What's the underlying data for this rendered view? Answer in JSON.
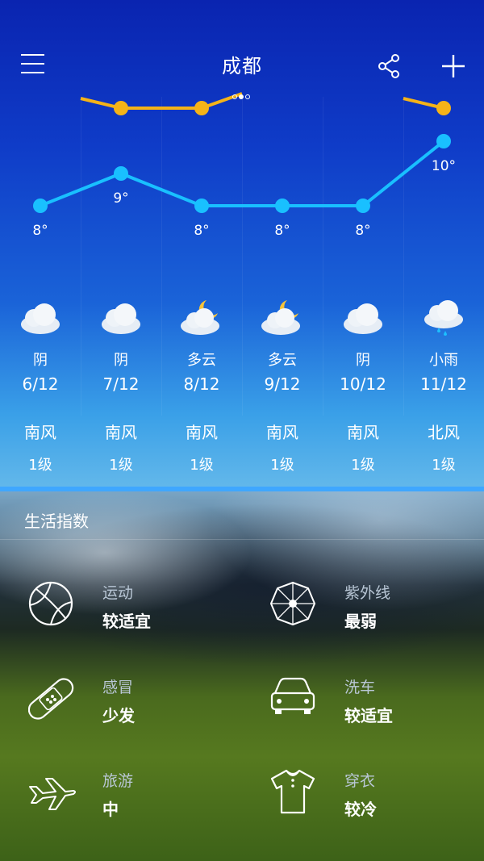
{
  "header": {
    "city": "成都",
    "page_count": 3,
    "active_page": 1
  },
  "chart_data": {
    "type": "line",
    "categories": [
      "6/12",
      "7/12",
      "8/12",
      "9/12",
      "10/12",
      "11/12"
    ],
    "series": [
      {
        "values": [
          8,
          9,
          8,
          8,
          8,
          10
        ],
        "labels": [
          "8°",
          "9°",
          "8°",
          "8°",
          "8°",
          "10°"
        ],
        "color": "#19c0ff"
      }
    ],
    "ylim": [
      3,
      11
    ],
    "partially_visible_series_color": "#f5b318"
  },
  "forecast": [
    {
      "condition": "阴",
      "date": "6/12",
      "icon": "cloudy-icon"
    },
    {
      "condition": "阴",
      "date": "7/12",
      "icon": "cloudy-icon"
    },
    {
      "condition": "多云",
      "date": "8/12",
      "icon": "cloud-moon-icon"
    },
    {
      "condition": "多云",
      "date": "9/12",
      "icon": "cloud-moon-icon"
    },
    {
      "condition": "阴",
      "date": "10/12",
      "icon": "cloudy-icon"
    },
    {
      "condition": "小雨",
      "date": "11/12",
      "icon": "light-rain-icon"
    }
  ],
  "wind": [
    {
      "direction": "南风",
      "level": "1级"
    },
    {
      "direction": "南风",
      "level": "1级"
    },
    {
      "direction": "南风",
      "level": "1级"
    },
    {
      "direction": "南风",
      "level": "1级"
    },
    {
      "direction": "南风",
      "level": "1级"
    },
    {
      "direction": "北风",
      "level": "1级"
    }
  ],
  "life_index": {
    "title": "生活指数",
    "items": [
      {
        "name": "运动",
        "value": "较适宜",
        "icon": "basketball-icon"
      },
      {
        "name": "紫外线",
        "value": "最弱",
        "icon": "umbrella-icon"
      },
      {
        "name": "感冒",
        "value": "少发",
        "icon": "bandage-icon"
      },
      {
        "name": "洗车",
        "value": "较适宜",
        "icon": "car-icon"
      },
      {
        "name": "旅游",
        "value": "中",
        "icon": "airplane-icon"
      },
      {
        "name": "穿衣",
        "value": "较冷",
        "icon": "tshirt-icon"
      }
    ]
  },
  "colors": {
    "accent": "#3fa7ff",
    "temp_line": "#19c0ff",
    "temp_high_line": "#f5b318"
  }
}
